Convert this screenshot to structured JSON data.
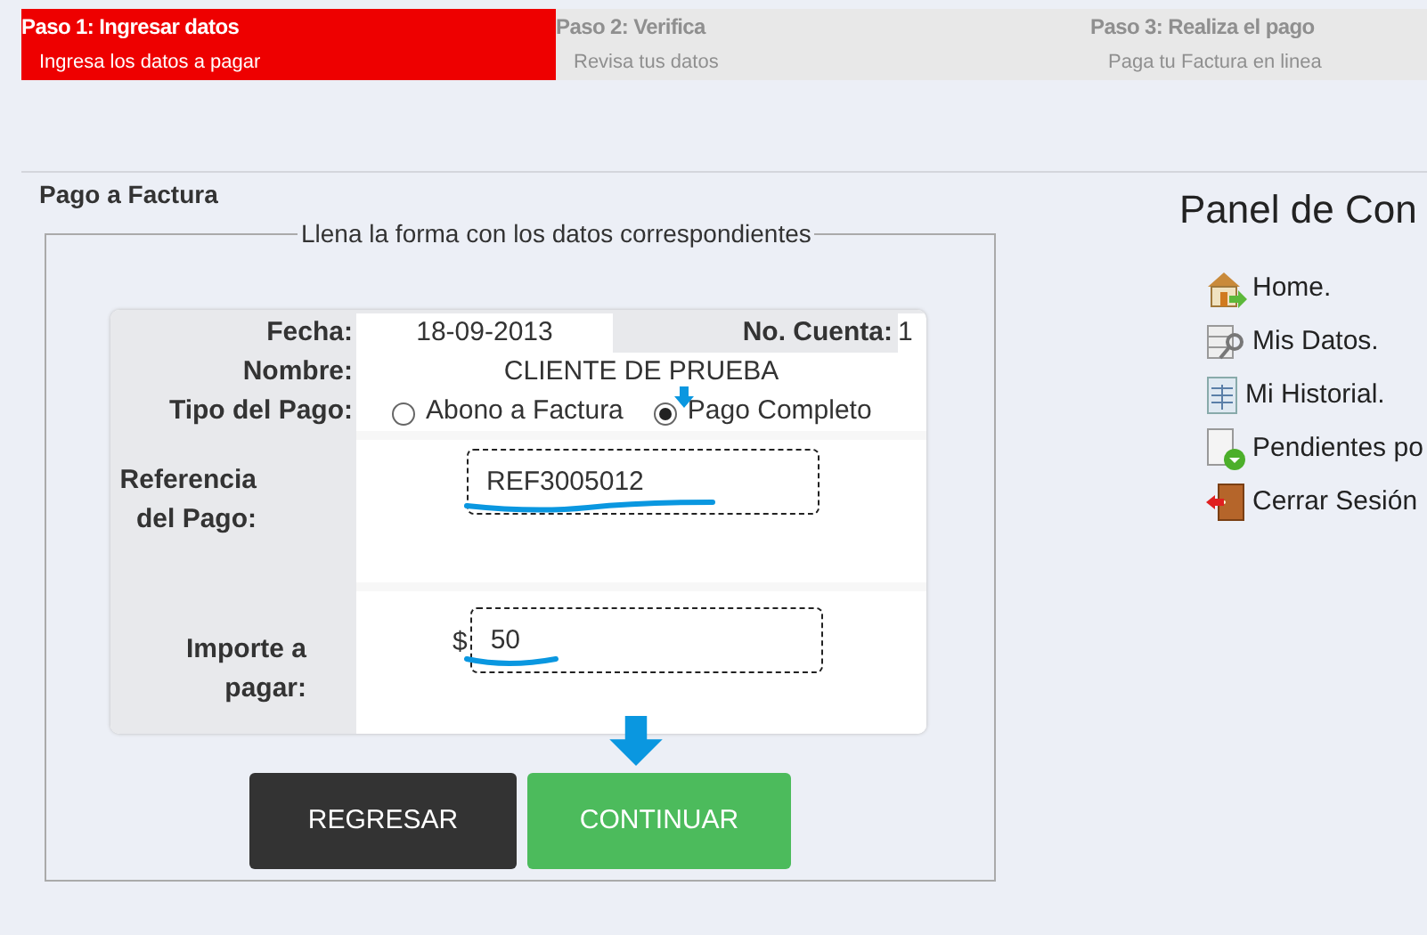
{
  "steps": [
    {
      "title": "Paso 1: Ingresar datos",
      "subtitle": "Ingresa los datos a pagar",
      "selected": true
    },
    {
      "title": "Paso 2: Verifica",
      "subtitle": "Revisa tus datos",
      "selected": false
    },
    {
      "title": "Paso 3: Realiza el pago",
      "subtitle": "Paga tu Factura en linea",
      "selected": false
    }
  ],
  "section_title": "Pago a Factura",
  "form": {
    "legend": "Llena la forma con los datos correspondientes",
    "fecha_label": "Fecha:",
    "fecha_value": "18-09-2013",
    "cuenta_label": "No. Cuenta:",
    "cuenta_value": "1",
    "nombre_label": "Nombre:",
    "nombre_value": "CLIENTE DE PRUEBA",
    "tipo_label": "Tipo del Pago:",
    "tipo_options": [
      {
        "label": "Abono a Factura",
        "selected": false
      },
      {
        "label": "Pago Completo",
        "selected": true
      }
    ],
    "referencia_label_lines": [
      "Referencia",
      "del Pago:"
    ],
    "referencia_value": "REF3005012",
    "importe_label_lines": [
      "Importe a",
      "pagar:"
    ],
    "currency": "$",
    "importe_value": "50"
  },
  "buttons": [
    {
      "label": "REGRESAR",
      "kind": "back"
    },
    {
      "label": "CONTINUAR",
      "kind": "next"
    }
  ],
  "panel": {
    "title": "Panel de Con",
    "items": [
      {
        "label": "Home.",
        "kind": "home"
      },
      {
        "label": "Mis Datos.",
        "kind": "data"
      },
      {
        "label": "Mi Historial.",
        "kind": "history"
      },
      {
        "label": "Pendientes po",
        "kind": "pending"
      },
      {
        "label": "Cerrar Sesión",
        "kind": "logout"
      }
    ]
  }
}
